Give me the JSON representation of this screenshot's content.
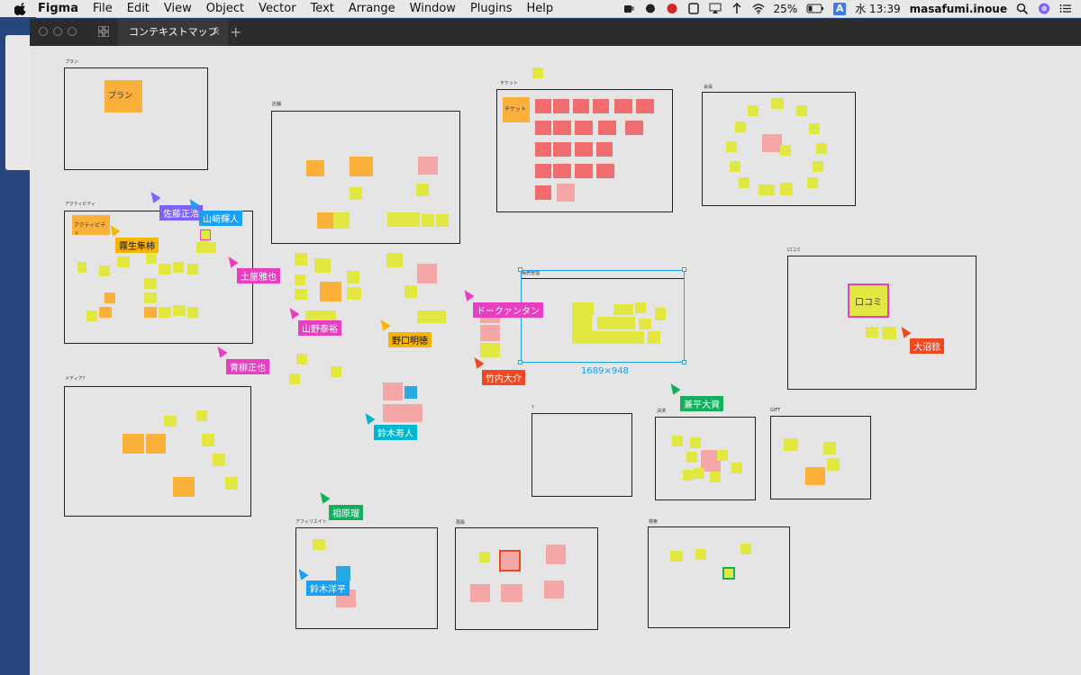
{
  "menubar": {
    "app": "Figma",
    "items": [
      "File",
      "Edit",
      "View",
      "Object",
      "Vector",
      "Text",
      "Arrange",
      "Window",
      "Plugins",
      "Help"
    ],
    "battery": "25%",
    "input_source": "A",
    "clock": "水 13:39",
    "user": "masafumi.inoue"
  },
  "tab": {
    "title": "コンテキストマップ",
    "close": "×",
    "add": "+"
  },
  "frames": [
    {
      "label": "プラン",
      "note": "プラン"
    },
    {
      "label": "アクティビティ",
      "note": "アクティビティ"
    },
    {
      "label": "メディア？"
    },
    {
      "label": "店舗"
    },
    {
      "label": "チケット",
      "note": "チケット"
    },
    {
      "label": "会員"
    },
    {
      "label": "販売管理"
    },
    {
      "label": "口コミ",
      "note": "口コミ"
    },
    {
      "label": "?"
    },
    {
      "label": "決済"
    },
    {
      "label": "GIFT"
    },
    {
      "label": "アフィリエイト"
    },
    {
      "label": "再販"
    },
    {
      "label": "検索"
    }
  ],
  "selection": {
    "dims": "1689×948"
  },
  "users": [
    {
      "name": "佐藤正浩",
      "color": "#7b61ff"
    },
    {
      "name": "山﨑輝人",
      "color": "#18a0fb"
    },
    {
      "name": "霧生隼柿",
      "color": "#f7b500"
    },
    {
      "name": "土屋雅也",
      "color": "#e83fc1"
    },
    {
      "name": "山野泰裕",
      "color": "#e83fc1"
    },
    {
      "name": "野口明徳",
      "color": "#f7b500"
    },
    {
      "name": "ドークァンタン",
      "color": "#e83fc1"
    },
    {
      "name": "竹内大介",
      "color": "#f24822"
    },
    {
      "name": "青柳正也",
      "color": "#e83fc1"
    },
    {
      "name": "鈴木寿人",
      "color": "#00b5ce"
    },
    {
      "name": "兼平大資",
      "color": "#14ae5c"
    },
    {
      "name": "大沼稔",
      "color": "#f24822"
    },
    {
      "name": "相原瑠",
      "color": "#14ae5c"
    },
    {
      "name": "鈴木洋平",
      "color": "#18a0fb"
    }
  ],
  "colors": {
    "selection": "#18a0fb"
  }
}
